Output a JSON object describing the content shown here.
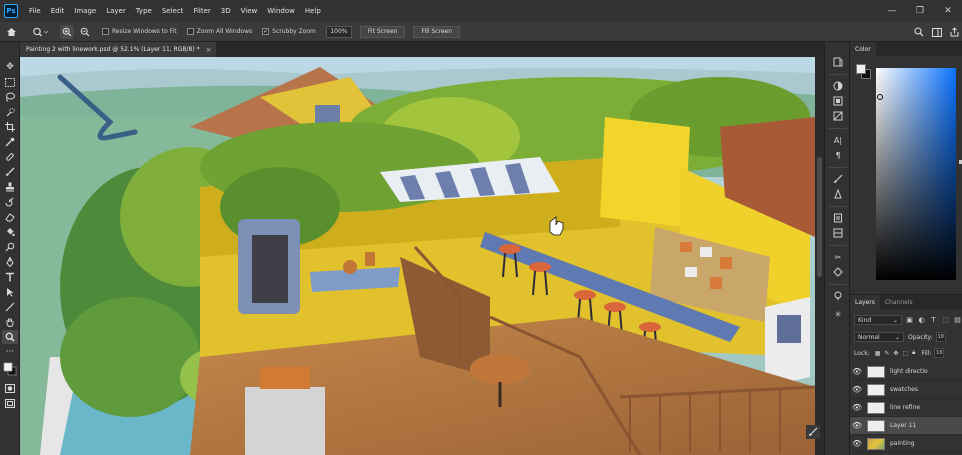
{
  "app": {
    "logo": "Ps"
  },
  "menu": [
    "File",
    "Edit",
    "Image",
    "Layer",
    "Type",
    "Select",
    "Filter",
    "3D",
    "View",
    "Window",
    "Help"
  ],
  "options": {
    "resize_windows": "Resize Windows to Fit",
    "zoom_all": "Zoom All Windows",
    "scrubby": "Scrubby Zoom",
    "zoom_value": "100%",
    "fit_screen": "Fit Screen",
    "fill_screen": "Fill Screen",
    "scrubby_checked": true
  },
  "document": {
    "tab_title": "Painting 2 with linework.psd @ 52.1% (Layer 11, RGB/8) *",
    "close": "×"
  },
  "color_panel": {
    "tab": "Color",
    "fg": "#f0f0f0",
    "bg": "#111111",
    "hue": "#0a72ff"
  },
  "layers_panel": {
    "tabs": [
      "Layers",
      "Channels"
    ],
    "kind": "Kind",
    "blend": "Normal",
    "opacity_label": "Opacity:",
    "opacity_value": "10",
    "lock_label": "Lock:",
    "fill_label": "Fill:",
    "fill_value": "10",
    "layers": [
      {
        "name": "light directio",
        "selected": false
      },
      {
        "name": "swatches",
        "selected": false
      },
      {
        "name": "line refine",
        "selected": false
      },
      {
        "name": "Layer 11",
        "selected": true
      },
      {
        "name": "painting",
        "selected": false
      }
    ]
  },
  "icons": {
    "home": "home-icon",
    "zoom": "zoom-tool-icon",
    "zoom_in": "zoom-in-icon",
    "zoom_out": "zoom-out-icon",
    "search": "search-icon",
    "workspace": "workspace-icon",
    "share": "share-icon"
  }
}
